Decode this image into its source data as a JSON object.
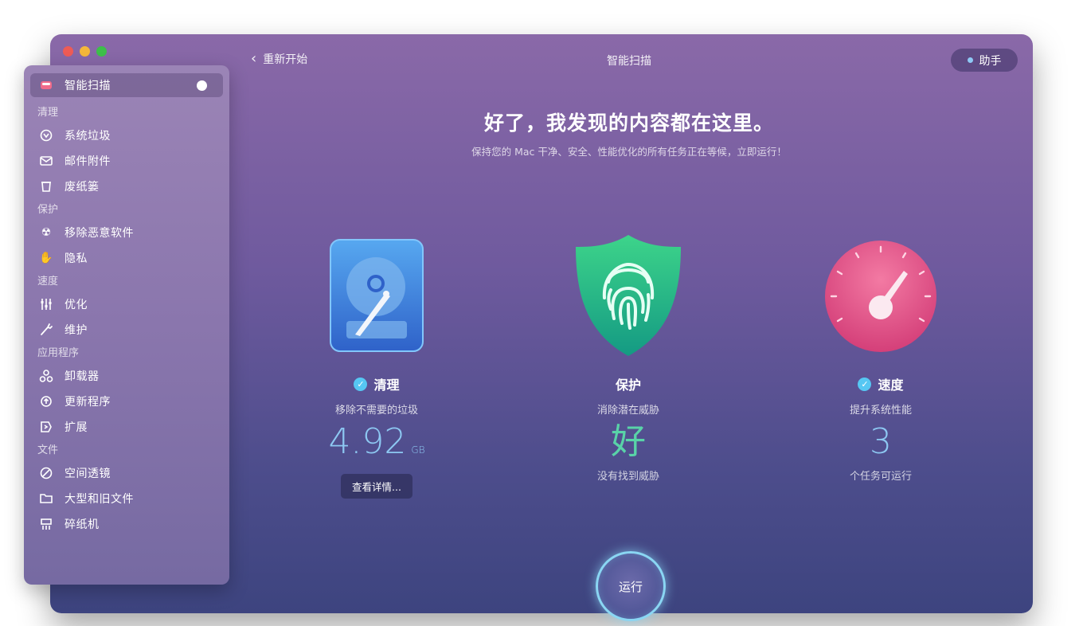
{
  "window": {
    "title": "智能扫描"
  },
  "toolbar": {
    "back_label": "重新开始",
    "title": "智能扫描",
    "assistant_label": "助手"
  },
  "sidebar": {
    "active_item": "智能扫描",
    "sections": [
      {
        "title": "清理",
        "items": [
          {
            "label": "系统垃圾",
            "icon": "system-junk-icon"
          },
          {
            "label": "邮件附件",
            "icon": "mail-icon"
          },
          {
            "label": "废纸篓",
            "icon": "trash-icon"
          }
        ]
      },
      {
        "title": "保护",
        "items": [
          {
            "label": "移除恶意软件",
            "icon": "biohazard-icon"
          },
          {
            "label": "隐私",
            "icon": "hand-icon"
          }
        ]
      },
      {
        "title": "速度",
        "items": [
          {
            "label": "优化",
            "icon": "sliders-icon"
          },
          {
            "label": "维护",
            "icon": "wrench-icon"
          }
        ]
      },
      {
        "title": "应用程序",
        "items": [
          {
            "label": "卸载器",
            "icon": "uninstaller-icon"
          },
          {
            "label": "更新程序",
            "icon": "updater-icon"
          },
          {
            "label": "扩展",
            "icon": "extensions-icon"
          }
        ]
      },
      {
        "title": "文件",
        "items": [
          {
            "label": "空间透镜",
            "icon": "space-lens-icon"
          },
          {
            "label": "大型和旧文件",
            "icon": "folder-icon"
          },
          {
            "label": "碎纸机",
            "icon": "shredder-icon"
          }
        ]
      }
    ]
  },
  "main": {
    "headline": "好了，我发现的内容都在这里。",
    "subline": "保持您的 Mac 干净、安全、性能优化的所有任务正在等候，立即运行！",
    "cards": [
      {
        "title": "清理",
        "desc": "移除不需要的垃圾",
        "value": "4.92",
        "unit": "GB",
        "button": "查看详情...",
        "checked": true,
        "icon": "hard-drive-icon",
        "value_color": "#8dc8f2"
      },
      {
        "title": "保护",
        "desc": "消除潜在威胁",
        "value": "好",
        "note": "没有找到威胁",
        "checked": false,
        "icon": "fingerprint-shield-icon",
        "value_color": "#59d3a8"
      },
      {
        "title": "速度",
        "desc": "提升系统性能",
        "value": "3",
        "note": "个任务可运行",
        "checked": true,
        "icon": "speedometer-icon",
        "value_color": "#8dc8f2"
      }
    ],
    "run_label": "运行"
  },
  "colors": {
    "accent": "#56c7f3",
    "window_top": "#8a69a8",
    "window_bottom": "#3d447f"
  }
}
